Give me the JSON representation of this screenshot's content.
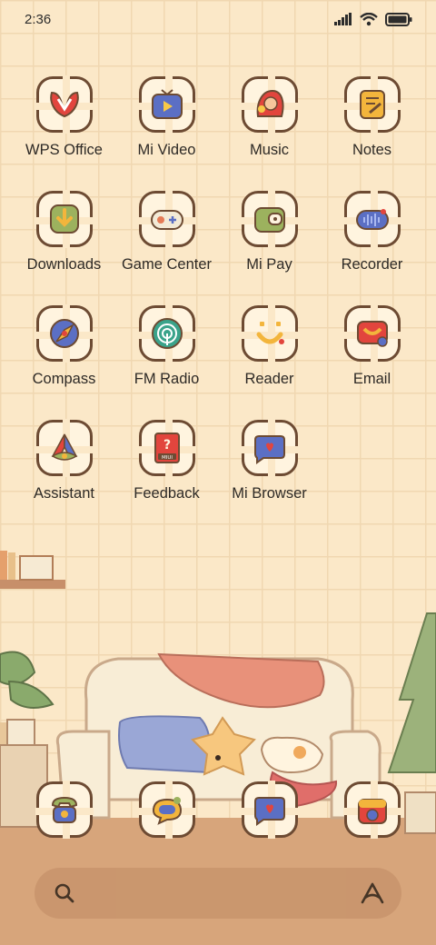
{
  "status": {
    "time": "2:36"
  },
  "apps": [
    {
      "label": "WPS Office",
      "icon": "wps-office-icon"
    },
    {
      "label": "Mi Video",
      "icon": "mi-video-icon"
    },
    {
      "label": "Music",
      "icon": "music-icon"
    },
    {
      "label": "Notes",
      "icon": "notes-icon"
    },
    {
      "label": "Downloads",
      "icon": "downloads-icon"
    },
    {
      "label": "Game Center",
      "icon": "game-center-icon"
    },
    {
      "label": "Mi Pay",
      "icon": "mi-pay-icon"
    },
    {
      "label": "Recorder",
      "icon": "recorder-icon"
    },
    {
      "label": "Compass",
      "icon": "compass-icon"
    },
    {
      "label": "FM Radio",
      "icon": "fm-radio-icon"
    },
    {
      "label": "Reader",
      "icon": "reader-icon"
    },
    {
      "label": "Email",
      "icon": "email-icon"
    },
    {
      "label": "Assistant",
      "icon": "assistant-icon"
    },
    {
      "label": "Feedback",
      "icon": "feedback-icon",
      "badge": "MIUI"
    },
    {
      "label": "Mi Browser",
      "icon": "mi-browser-icon"
    }
  ],
  "dock": [
    {
      "icon": "phone-icon"
    },
    {
      "icon": "messages-icon"
    },
    {
      "icon": "browser-icon"
    },
    {
      "icon": "camera-icon"
    }
  ],
  "search": {
    "icon": "search-icon",
    "assistant_icon": "assistant-logo-icon"
  }
}
